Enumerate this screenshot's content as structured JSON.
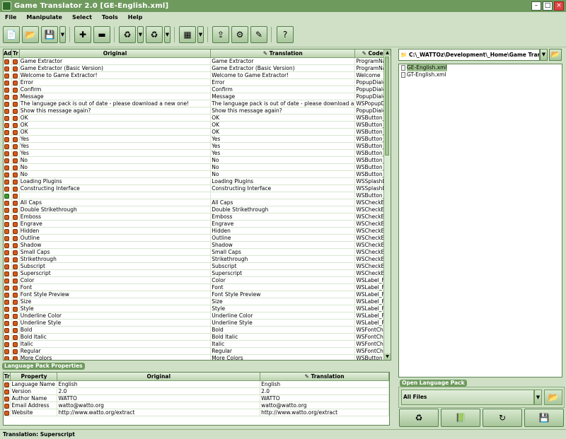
{
  "window": {
    "title": "Game Translator 2.0 [GE-English.xml]"
  },
  "menu": [
    "File",
    "Manipulate",
    "Select",
    "Tools",
    "Help"
  ],
  "colors": {
    "accent": "#6f9a5e",
    "background": "#cfe0c6"
  },
  "toolbar_icons": [
    "new-icon",
    "open-icon",
    "save-icon",
    "add-icon",
    "remove-icon",
    "translate-icon",
    "auto-translate-icon",
    "table-view-icon",
    "import-icon",
    "export-icon",
    "settings-icon",
    "help-icon"
  ],
  "table": {
    "headers": [
      "Ad",
      "Tr",
      "Original",
      "Translation",
      "Code"
    ],
    "rows": [
      [
        "Game Extractor",
        "Game Extractor",
        "ProgramNa"
      ],
      [
        "Game Extractor (Basic Version)",
        "Game Extractor (Basic Version)",
        "ProgramNa"
      ],
      [
        "Welcome to Game Extractor!",
        "Welcome to Game Extractor!",
        "Welcome"
      ],
      [
        "Error",
        "Error",
        "PopupDialo"
      ],
      [
        "Confirm",
        "Confirm",
        "PopupDialo"
      ],
      [
        "Message",
        "Message",
        "PopupDialo"
      ],
      [
        "The language pack is out of date - please download a new one!",
        "The language pack is out of date - please download a",
        "WSPopupD"
      ],
      [
        "Show this message again?",
        "Show this message again?",
        "PopupDialo"
      ],
      [
        "OK",
        "OK",
        "WSButton_("
      ],
      [
        "OK",
        "OK",
        "WSButton_("
      ],
      [
        "OK",
        "OK",
        "WSButton_("
      ],
      [
        "Yes",
        "Yes",
        "WSButton_\\"
      ],
      [
        "Yes",
        "Yes",
        "WSButton_\\"
      ],
      [
        "Yes",
        "Yes",
        "WSButton_\\"
      ],
      [
        "No",
        "No",
        "WSButton_N"
      ],
      [
        "No",
        "No",
        "WSButton_N"
      ],
      [
        "No",
        "No",
        "WSButton_N"
      ],
      [
        "Loading Plugins",
        "Loading Plugins",
        "WSSplashD"
      ],
      [
        "Constructing Interface",
        "Constructing Interface",
        "WSSplashD"
      ],
      [
        "",
        "",
        "WSButton_("
      ],
      [
        "All Caps",
        "All Caps",
        "WSCheckBo"
      ],
      [
        "Double Strikethrough",
        "Double Strikethrough",
        "WSCheckBo"
      ],
      [
        "Emboss",
        "Emboss",
        "WSCheckBo"
      ],
      [
        "Engrave",
        "Engrave",
        "WSCheckBo"
      ],
      [
        "Hidden",
        "Hidden",
        "WSCheckBo"
      ],
      [
        "Outline",
        "Outline",
        "WSCheckBo"
      ],
      [
        "Shadow",
        "Shadow",
        "WSCheckBo"
      ],
      [
        "Small Caps",
        "Small Caps",
        "WSCheckBo"
      ],
      [
        "Strikethrough",
        "Strikethrough",
        "WSCheckBo"
      ],
      [
        "Subscript",
        "Subscript",
        "WSCheckBo"
      ],
      [
        "Superscript",
        "Superscript",
        "WSCheckBo"
      ],
      [
        "Color",
        "Color",
        "WSLabel_F"
      ],
      [
        "Font",
        "Font",
        "WSLabel_F"
      ],
      [
        "Font Style Preview",
        "Font Style Preview",
        "WSLabel_F"
      ],
      [
        "Size",
        "Size",
        "WSLabel_F"
      ],
      [
        "Style",
        "Style",
        "WSLabel_F"
      ],
      [
        "Underline Color",
        "Underline Color",
        "WSLabel_F"
      ],
      [
        "Underline Style",
        "Underline Style",
        "WSLabel_F"
      ],
      [
        "Bold",
        "Bold",
        "WSFontCho"
      ],
      [
        "Bold Italic",
        "Bold Italic",
        "WSFontCho"
      ],
      [
        "Italic",
        "Italic",
        "WSFontCho"
      ],
      [
        "Regular",
        "Regular",
        "WSFontCho"
      ],
      [
        "More Colors",
        "More Colors",
        "WSButton_("
      ]
    ]
  },
  "properties": {
    "section_title": "Language Pack Properties",
    "headers": [
      "Tr",
      "Property",
      "Original",
      "Translation"
    ],
    "rows": [
      [
        "Language Name",
        "English",
        "English"
      ],
      [
        "Version",
        "2.0",
        "2.0"
      ],
      [
        "Author Name",
        "WATTO",
        "WATTO"
      ],
      [
        "Email Address",
        "watto@watto.org",
        "watto@watto.org"
      ],
      [
        "Website",
        "http://www.watto.org/extract",
        "http://www.watto.org/extract"
      ]
    ]
  },
  "right": {
    "path": "C:\\_WATTOz\\Development\\_Home\\Game Translato",
    "files": [
      "GE-English.xml",
      "GT-English.xml"
    ],
    "open_label": "Open Language Pack",
    "filter_value": "All Files"
  },
  "status": "Translation: Superscript"
}
